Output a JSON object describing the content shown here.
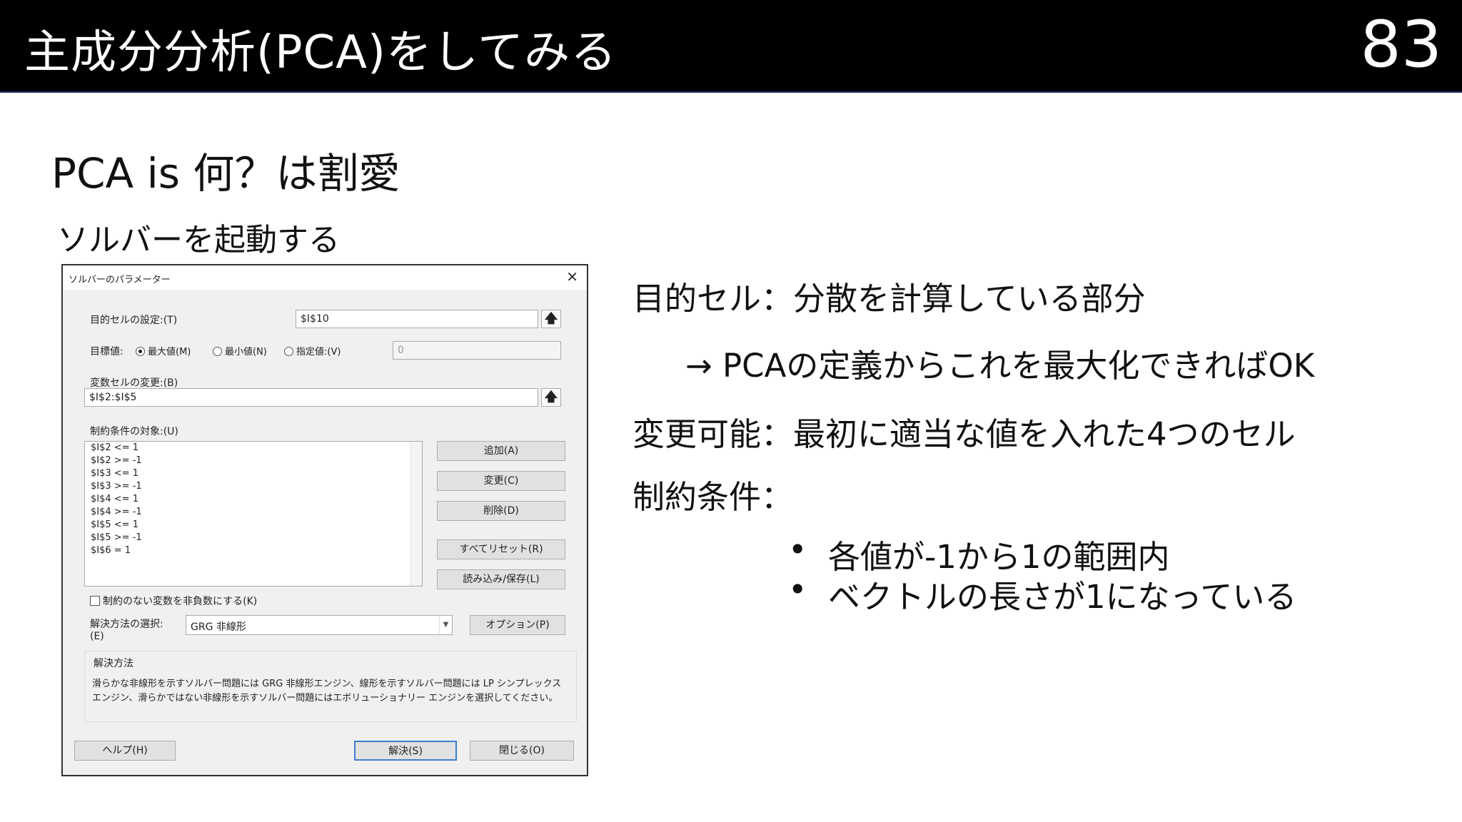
{
  "header": {
    "title": "主成分分析(PCA)をしてみる",
    "page_number": "83"
  },
  "subtitle": "PCA is 何？は割愛",
  "caption": "ソルバーを起動する",
  "dialog": {
    "title": "ソルバーのパラメーター",
    "close_glyph": "✕",
    "objective_label": "目的セルの設定:(T)",
    "objective_value": "$I$10",
    "target_label": "目標値:",
    "radio_max": "最大値(M)",
    "radio_min": "最小値(N)",
    "radio_value": "指定値:(V)",
    "target_value": "0",
    "variable_label": "変数セルの変更:(B)",
    "variable_value": "$I$2:$I$5",
    "constraints_label": "制約条件の対象:(U)",
    "constraints": [
      "$I$2 <= 1",
      "$I$2 >= -1",
      "$I$3 <= 1",
      "$I$3 >= -1",
      "$I$4 <= 1",
      "$I$4 >= -1",
      "$I$5 <= 1",
      "$I$5 >= -1",
      "$I$6 = 1"
    ],
    "btn_add": "追加(A)",
    "btn_change": "変更(C)",
    "btn_delete": "削除(D)",
    "btn_reset": "すべてリセット(R)",
    "btn_load_save": "読み込み/保存(L)",
    "nonneg_label": "制約のない変数を非負数にする(K)",
    "method_label_1": "解決方法の選択:",
    "method_label_2": "(E)",
    "method_value": "GRG 非線形",
    "btn_options": "オプション(P)",
    "desc_title": "解決方法",
    "desc_line_1": "滑らかな非線形を示すソルバー問題には GRG 非線形エンジン、線形を示すソルバー問題には LP シンプレックス",
    "desc_line_2": "エンジン、滑らかではない非線形を示すソルバー問題にはエボリューショナリー エンジンを選択してください。",
    "btn_help": "ヘルプ(H)",
    "btn_solve": "解決(S)",
    "btn_close": "閉じる(O)",
    "up_arrow": "🡅"
  },
  "right": {
    "objective": "目的セル：分散を計算している部分",
    "objective_note": "→ PCAの定義からこれを最大化できればOK",
    "variable": "変更可能：最初に適当な値を入れた4つのセル",
    "constraint_title": "制約条件：",
    "bullets": [
      "各値が-1から1の範囲内",
      "ベクトルの長さが1になっている"
    ],
    "bullet_glyph": "•"
  }
}
